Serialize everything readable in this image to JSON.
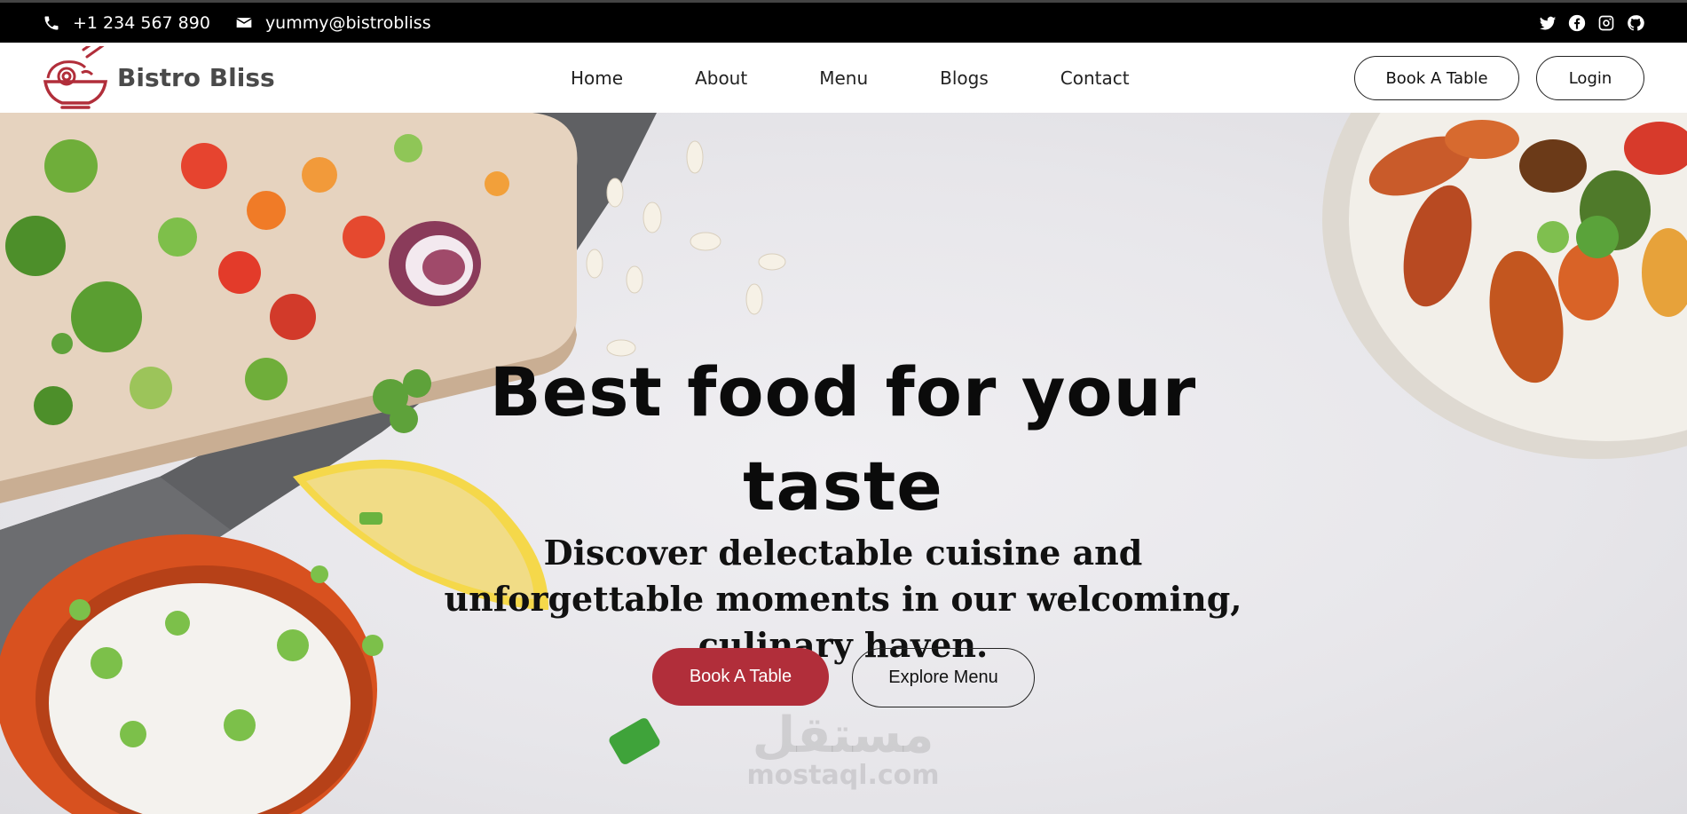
{
  "topbar": {
    "phone": "+1 234 567 890",
    "email": "yummy@bistrobliss",
    "phone_icon": "phone-icon",
    "email_icon": "envelope-icon",
    "social": [
      "twitter-icon",
      "facebook-icon",
      "instagram-icon",
      "github-icon"
    ]
  },
  "brand": {
    "name": "Bistro Bliss",
    "logo_icon": "noodle-bowl-logo"
  },
  "nav": {
    "links": [
      "Home",
      "About",
      "Menu",
      "Blogs",
      "Contact"
    ],
    "book_label": "Book A Table",
    "login_label": "Login"
  },
  "hero": {
    "title": "Best food for your taste",
    "subtitle": "Discover delectable cuisine and unforgettable moments in our welcoming, culinary haven.",
    "primary_button": "Book A Table",
    "secondary_button": "Explore Menu"
  },
  "watermark": {
    "arabic": "مستقل",
    "latin": "mostaql.com"
  },
  "colors": {
    "accent": "#b12e3a",
    "topbar": "#000000",
    "text": "#111111"
  }
}
